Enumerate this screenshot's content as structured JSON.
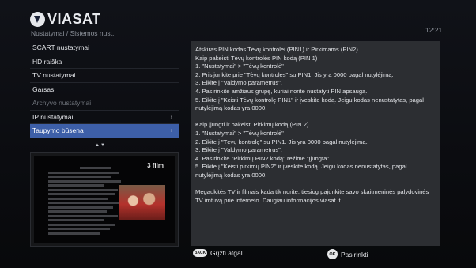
{
  "header": {
    "logo_text": "VIASAT",
    "breadcrumb": "Nustatymai / Sistemos nust.",
    "clock": "12:21"
  },
  "menu": {
    "items": [
      {
        "label": "SCART nustatymai"
      },
      {
        "label": "HD raiška"
      },
      {
        "label": "TV nustatymai"
      },
      {
        "label": "Garsas"
      },
      {
        "label": "Archyvo nustatymai"
      },
      {
        "label": "IP nustatymai",
        "arrow": "›"
      },
      {
        "label": "Taupymo būsena",
        "arrow": "›"
      }
    ],
    "selected_index": 6,
    "scroll_hint": "▲▼"
  },
  "preview": {
    "channel_logo": "3 film"
  },
  "panel": {
    "lines": [
      "Atskiras PIN kodas Tėvų kontrolei (PIN1) ir Pirkimams (PIN2)",
      "Kaip pakeisti Tėvų kontrolės PIN kodą (PIN 1)",
      "1. \"Nustatymai\" > \"Tėvų kontrolė\"",
      "2. Prisijunkite prie \"Tėvų kontrolės\" su PIN1. Jis yra 0000 pagal nutylėjimą.",
      "3. Eikite į \"Valdymo parametrus\".",
      "4. Pasirinkite amžiaus grupę, kuriai norite nustatyti PIN apsaugą.",
      "5. Eikite į \"Keisti Tėvų kontrolę PIN1\" ir įveskite kodą.  Jeigu kodas nenustatytas, pagal nutylėjimą kodas yra 0000.",
      "",
      "Kaip įjungti ir pakeisti Pirkimų kodą (PIN 2)",
      "1. \"Nustatymai\" > \"Tėvų kontrolė\"",
      "2. Eikite į \"Tėvų kontrolę\" su PIN1. Jis yra 0000 pagal nutylėjimą.",
      "3. Eikite į \"Valdymo parametrus\".",
      "4. Pasirinkite \"Pirkimų PIN2 kodą\" režime \"Įjungta\".",
      "5. Eikite į \"Keisti pirkimų PIN2\" ir įveskite kodą. Jeigu kodas nenustatytas, pagal nutylėjimą kodas yra 0000.",
      "",
      "Mėgaukitės TV ir filmais kada tik norite: tiesiog pajunkite savo skaitmeninės palydovinės TV imtuvą prie interneto. Daugiau informacijos  viasat.lt"
    ]
  },
  "footer": {
    "back_key": "BACK",
    "back_label": "Grįžti atgal",
    "ok_key": "OK",
    "ok_label": "Pasirinkti"
  }
}
